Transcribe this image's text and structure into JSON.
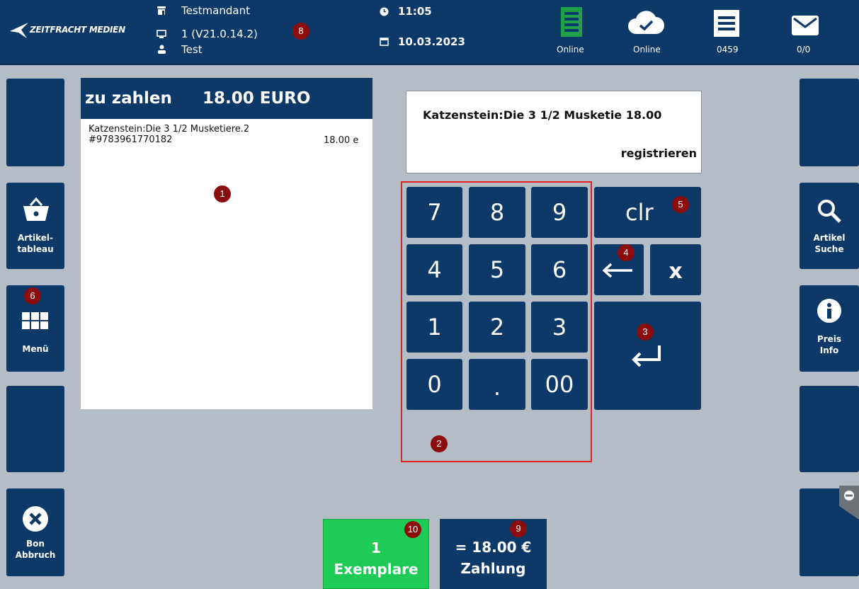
{
  "topbar": {
    "brand": "ZEITFRACHT MEDIEN",
    "store": "Testmandant",
    "terminal": "1 (V21.0.14.2)",
    "user": "Test",
    "time": "11:05",
    "date": "10.03.2023",
    "status1_label": "Online",
    "status2_label": "Online",
    "receipt_number": "0459",
    "messages": "0/0"
  },
  "left_sidebar": {
    "articles_label_line1": "Artikel-",
    "articles_label_line2": "tableau",
    "menu_label": "Menü",
    "cancel_label_line1": "Bon",
    "cancel_label_line2": "Abbruch"
  },
  "right_sidebar": {
    "search_label_line1": "Artikel",
    "search_label_line2": "Suche",
    "price_label_line1": "Preis",
    "price_label_line2": "Info"
  },
  "receipt": {
    "header_label": "zu zahlen",
    "header_amount": "18.00 EURO",
    "item_title": "Katzenstein:Die 3 1/2 Musketiere.2",
    "item_isbn": "#9783961770182",
    "item_price": "18.00 e"
  },
  "display": {
    "line1": "Katzenstein:Die 3 1/2 Musketie 18.00",
    "line2": "registrieren"
  },
  "numpad": {
    "k7": "7",
    "k8": "8",
    "k9": "9",
    "k4": "4",
    "k5": "5",
    "k6": "6",
    "k1": "1",
    "k2": "2",
    "k3": "3",
    "k0": "0",
    "kdot": ".",
    "k00": "00",
    "clr": "clr",
    "mult": "x"
  },
  "bottom": {
    "qty_line1": "1",
    "qty_line2": "Exemplare",
    "pay_line1": "= 18.00 €",
    "pay_line2": "Zahlung"
  },
  "badges": {
    "b1": "1",
    "b2": "2",
    "b3": "3",
    "b4": "4",
    "b5": "5",
    "b6": "6",
    "b8": "8",
    "b9": "9",
    "b10": "10"
  },
  "colors": {
    "navy": "#0d3968",
    "background": "#b4bcc6",
    "green": "#1ecb56",
    "badge": "#8b0d0d",
    "highlight": "#e02020"
  }
}
